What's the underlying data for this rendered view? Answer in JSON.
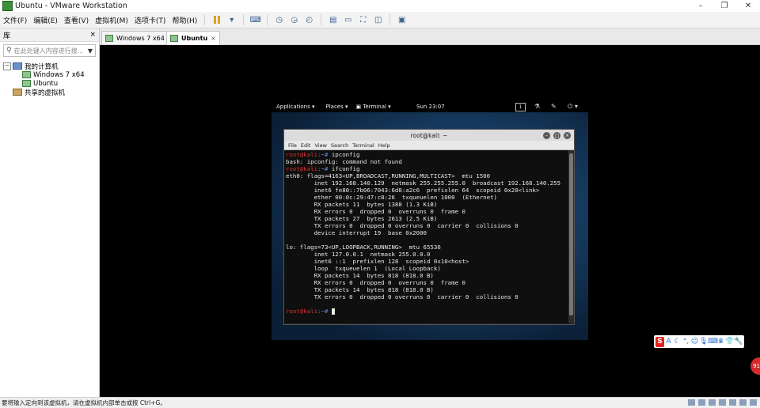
{
  "window": {
    "title": "Ubuntu - VMware Workstation",
    "minimize": "–",
    "maximize": "❐",
    "close": "✕"
  },
  "menu": {
    "items": [
      "文件(F)",
      "编辑(E)",
      "查看(V)",
      "虚拟机(M)",
      "选项卡(T)",
      "帮助(H)"
    ]
  },
  "library": {
    "header": "库",
    "close_glyph": "×",
    "search_placeholder": "在此处键入内容进行搜...",
    "tree": {
      "root": "我的计算机",
      "vm1": "Windows 7 x64",
      "vm2": "Ubuntu",
      "shared": "共享的虚拟机"
    }
  },
  "tabs": [
    {
      "label": "Windows 7 x64",
      "close": "×"
    },
    {
      "label": "Ubuntu",
      "close": "×"
    }
  ],
  "guest": {
    "topbar": {
      "applications": "Applications ▾",
      "places": "Places ▾",
      "terminal": "Terminal ▾",
      "clock": "Sun 23:07",
      "workspace": "1"
    },
    "terminal": {
      "title": "root@kali: ~",
      "menu": [
        "File",
        "Edit",
        "View",
        "Search",
        "Terminal",
        "Help"
      ],
      "prompt_user": "root@kali",
      "prompt_sym": ":~#",
      "commands": [
        " ipconfig",
        " ifconfig"
      ],
      "output": [
        "bash: ipconfig: command not found",
        "eth0: flags=4163<UP,BROADCAST,RUNNING,MULTICAST>  mtu 1500",
        "        inet 192.168.140.129  netmask 255.255.255.0  broadcast 192.168.140.255",
        "        inet6 fe80::7b06:7043:6d8:a2c6  prefixlen 64  scopeid 0x20<link>",
        "        ether 00:0c:29:47:c8:26  txqueuelen 1000  (Ethernet)",
        "        RX packets 11  bytes 1388 (1.3 KiB)",
        "        RX errors 0  dropped 0  overruns 0  frame 0",
        "        TX packets 27  bytes 2613 (2.5 KiB)",
        "        TX errors 0  dropped 0 overruns 0  carrier 0  collisions 0",
        "        device interrupt 19  base 0x2000",
        "",
        "lo: flags=73<UP,LOOPBACK,RUNNING>  mtu 65536",
        "        inet 127.0.0.1  netmask 255.0.0.0",
        "        inet6 ::1  prefixlen 128  scopeid 0x10<host>",
        "        loop  txqueuelen 1  (Local Loopback)",
        "        RX packets 14  bytes 818 (818.0 B)",
        "        RX errors 0  dropped 0  overruns 0  frame 0",
        "        TX packets 14  bytes 818 (818.0 B)",
        "        TX errors 0  dropped 0 overruns 0  carrier 0  collisions 0",
        ""
      ]
    }
  },
  "ime": {
    "logo": "S",
    "mode": "A"
  },
  "badge": "91",
  "status": {
    "message": "要将输入定向到该虚拟机，请在虚拟机内部单击或按 Ctrl+G。"
  },
  "colors": {
    "prompt_user": "#e03030",
    "prompt_sym": "#5b8fe8",
    "ime_logo": "#e1251b"
  }
}
